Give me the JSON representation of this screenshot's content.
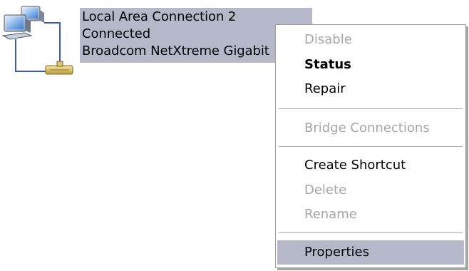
{
  "connection": {
    "icon": "network-connection-icon",
    "lines": [
      "Local Area Connection 2",
      "Connected",
      "Broadcom NetXtreme Gigabit"
    ],
    "selection_color": "#b5b8c9"
  },
  "context_menu": {
    "items": [
      {
        "label": "Disable",
        "enabled": false
      },
      {
        "label": "Status",
        "enabled": true,
        "default": true
      },
      {
        "label": "Repair",
        "enabled": true
      },
      {
        "label": "Bridge Connections",
        "enabled": false
      },
      {
        "label": "Create Shortcut",
        "enabled": true
      },
      {
        "label": "Delete",
        "enabled": false
      },
      {
        "label": "Rename",
        "enabled": false
      },
      {
        "label": "Properties",
        "enabled": true,
        "highlighted": true
      }
    ],
    "disabled_color": "#a6a6a6",
    "highlight_color": "#b5b8c9"
  }
}
